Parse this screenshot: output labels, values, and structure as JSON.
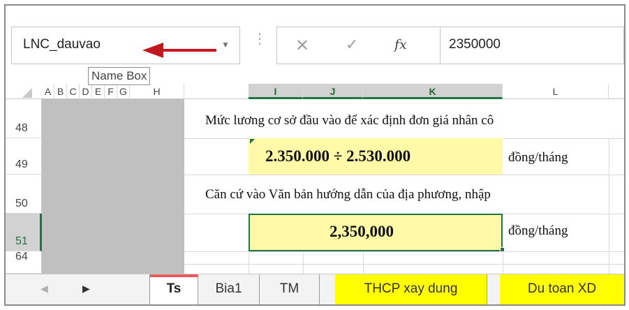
{
  "formula_bar": {
    "name_box_value": "LNC_dauvao",
    "name_box_tooltip": "Name Box",
    "formula_value": "2350000",
    "fx_label": "fx"
  },
  "columns": [
    "A",
    "B",
    "C",
    "D",
    "E",
    "F",
    "G",
    "H",
    "I",
    "J",
    "K",
    "L"
  ],
  "rows": [
    "48",
    "49",
    "50",
    "51",
    "64"
  ],
  "cells": {
    "row48_text": "Mức lương cơ sở đầu vào để xác định đơn giá nhân cô",
    "row49_range": "2.350.000 ÷ 2.530.000",
    "row49_unit": "đồng/tháng",
    "row50_text": "Căn cứ vào Văn  bản hướng dẫn của địa phương, nhập",
    "row51_value": "2,350,000",
    "row51_unit": "đồng/tháng"
  },
  "sheet_tabs": [
    "Ts",
    "Bia1",
    "TM",
    "THCP xay dung",
    "Du toan XD"
  ],
  "active_tab": "Ts",
  "colors": {
    "accent_green": "#217346",
    "cell_yellow": "#fff9a8",
    "tab_yellow": "#ffff00",
    "arrow_red": "#c0181e",
    "active_tab_underline": "#e95b5b"
  },
  "icons": {
    "dropdown": "chevron-down-icon",
    "cancel": "close-icon",
    "enter": "checkmark-icon",
    "function": "fx-icon",
    "arrow": "arrow-left-icon",
    "prev": "triangle-left-icon",
    "next": "triangle-right-icon"
  }
}
